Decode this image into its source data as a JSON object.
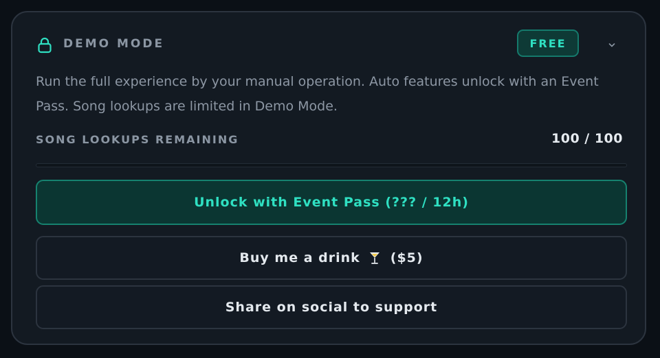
{
  "panel": {
    "title": "DEMO MODE",
    "icon": "lock-icon",
    "badge": "FREE",
    "description": "Run the full experience by your manual operation. Auto features unlock with an Event Pass. Song lookups are limited in Demo Mode.",
    "lookups": {
      "label": "SONG LOOKUPS REMAINING",
      "count": "100 / 100",
      "used_fraction": 0
    },
    "buttons": {
      "unlock": "Unlock with Event Pass (??? / 12h)",
      "drink_prefix": "Buy me a drink",
      "drink_icon": "cocktail-glass-icon",
      "drink_suffix": "($5)",
      "share": "Share on social to support"
    }
  },
  "colors": {
    "background": "#0b1016",
    "card": "#131a22",
    "accent": "#2fe0c2",
    "accent_bg": "#0b3632",
    "muted_text": "#8b96a3",
    "bright_text": "#e6ebf0"
  }
}
